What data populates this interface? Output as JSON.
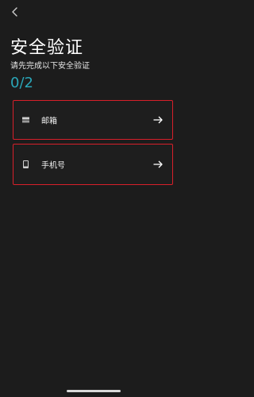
{
  "header": {
    "back_icon": "chevron-left-icon",
    "title": "安全验证",
    "subtitle": "请先完成以下安全验证",
    "progress": "0/2"
  },
  "options": [
    {
      "label": "邮箱",
      "icon": "mailbox-icon",
      "arrow_icon": "arrow-right-icon"
    },
    {
      "label": "手机号",
      "icon": "phone-icon",
      "arrow_icon": "arrow-right-icon"
    }
  ],
  "colors": {
    "background": "#1c1c1c",
    "accent": "#2aa6b8",
    "highlight_border": "#d81f2a"
  }
}
